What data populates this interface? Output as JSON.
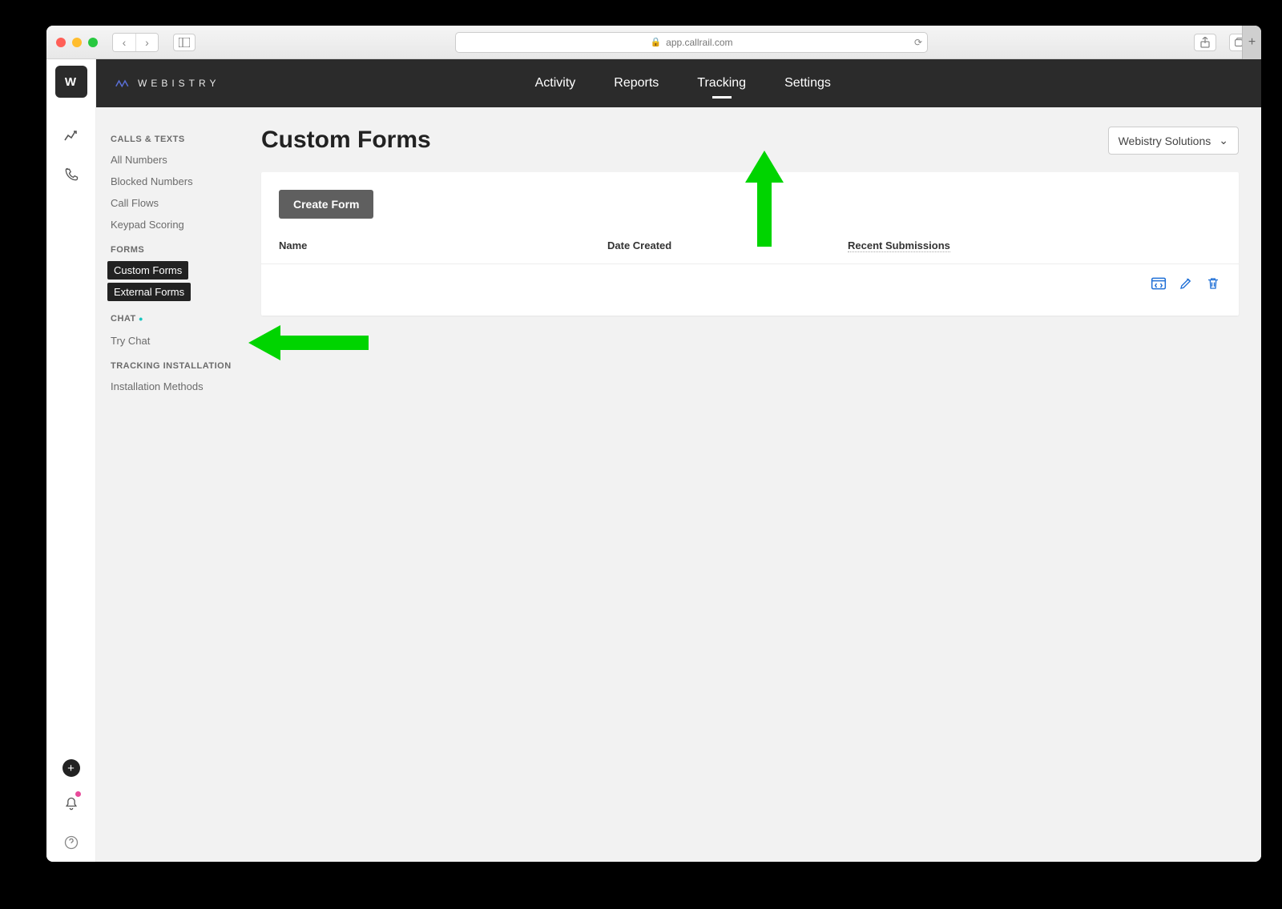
{
  "browser": {
    "url": "app.callrail.com"
  },
  "left_rail": {
    "brand_letter": "W"
  },
  "topbar": {
    "brand": "WEBISTRY",
    "nav": {
      "activity": "Activity",
      "reports": "Reports",
      "tracking": "Tracking",
      "settings": "Settings"
    }
  },
  "sidebar": {
    "sections": {
      "calls_texts": {
        "head": "CALLS & TEXTS",
        "items": {
          "all_numbers": "All Numbers",
          "blocked_numbers": "Blocked Numbers",
          "call_flows": "Call Flows",
          "keypad_scoring": "Keypad Scoring"
        }
      },
      "forms": {
        "head": "FORMS",
        "items": {
          "custom_forms": "Custom Forms",
          "external_forms": "External Forms"
        }
      },
      "chat": {
        "head": "CHAT",
        "items": {
          "try_chat": "Try Chat"
        }
      },
      "tracking_install": {
        "head": "TRACKING INSTALLATION",
        "items": {
          "install_methods": "Installation Methods"
        }
      }
    }
  },
  "page": {
    "title": "Custom Forms",
    "account_dropdown": "Webistry Solutions",
    "create_button": "Create Form",
    "columns": {
      "name": "Name",
      "date_created": "Date Created",
      "recent_submissions": "Recent Submissions"
    }
  }
}
